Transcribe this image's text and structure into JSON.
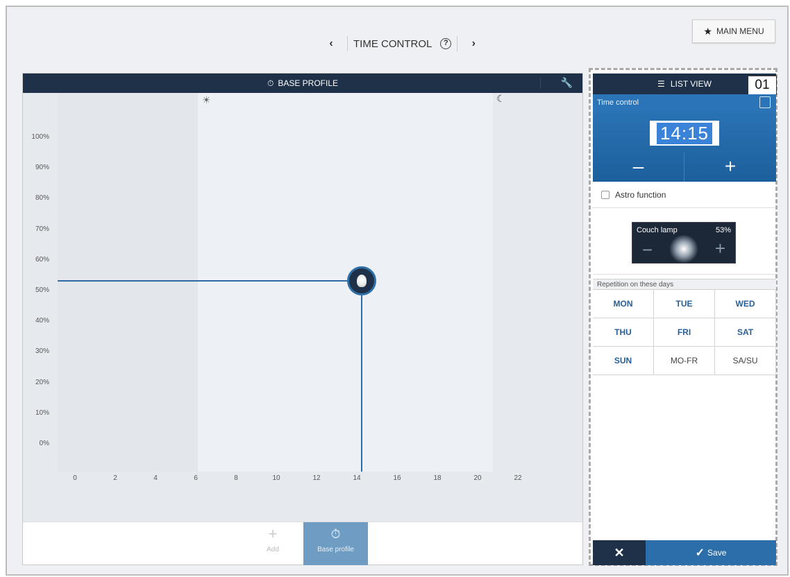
{
  "header": {
    "title": "TIME CONTROL",
    "help_icon": "?",
    "prev_icon": "‹",
    "next_icon": "›",
    "main_menu_label": "MAIN MENU"
  },
  "chart_panel": {
    "title": "BASE PROFILE",
    "y_ticks": [
      "100%",
      "90%",
      "80%",
      "70%",
      "60%",
      "50%",
      "40%",
      "30%",
      "20%",
      "10%",
      "0%"
    ],
    "x_ticks": [
      "0",
      "2",
      "4",
      "6",
      "8",
      "10",
      "12",
      "14",
      "16",
      "18",
      "20",
      "22"
    ],
    "footer": {
      "add_label": "Add",
      "base_profile_label": "Base profile"
    }
  },
  "chart_data": {
    "type": "line",
    "x_ticks": [
      "0",
      "2",
      "4",
      "6",
      "8",
      "10",
      "12",
      "14",
      "16",
      "18",
      "20",
      "22"
    ],
    "y_ticks": [
      "0%",
      "10%",
      "20%",
      "30%",
      "40%",
      "50%",
      "60%",
      "70%",
      "80%",
      "90%",
      "100%"
    ],
    "points": [
      {
        "x": 14,
        "y": 53
      }
    ],
    "daytime_from": 6,
    "daytime_to": 21
  },
  "side_panel": {
    "list_view_label": "LIST VIEW",
    "marker": "01",
    "time_control_label": "Time control",
    "time_value": "14:15",
    "minus_label": "–",
    "plus_label": "+",
    "astro_label": "Astro function",
    "lamp": {
      "name": "Couch lamp",
      "value": "53%"
    },
    "repetition_label": "Repetition on these days",
    "days": [
      "MON",
      "TUE",
      "WED",
      "THU",
      "FRI",
      "SAT",
      "SUN",
      "MO-FR",
      "SA/SU"
    ],
    "save_label": "Save",
    "cancel_label": "✕"
  },
  "colors": {
    "header_navy": "#1e3148",
    "accent_blue": "#2c6ea9",
    "time_highlight": "#3b83d8"
  }
}
